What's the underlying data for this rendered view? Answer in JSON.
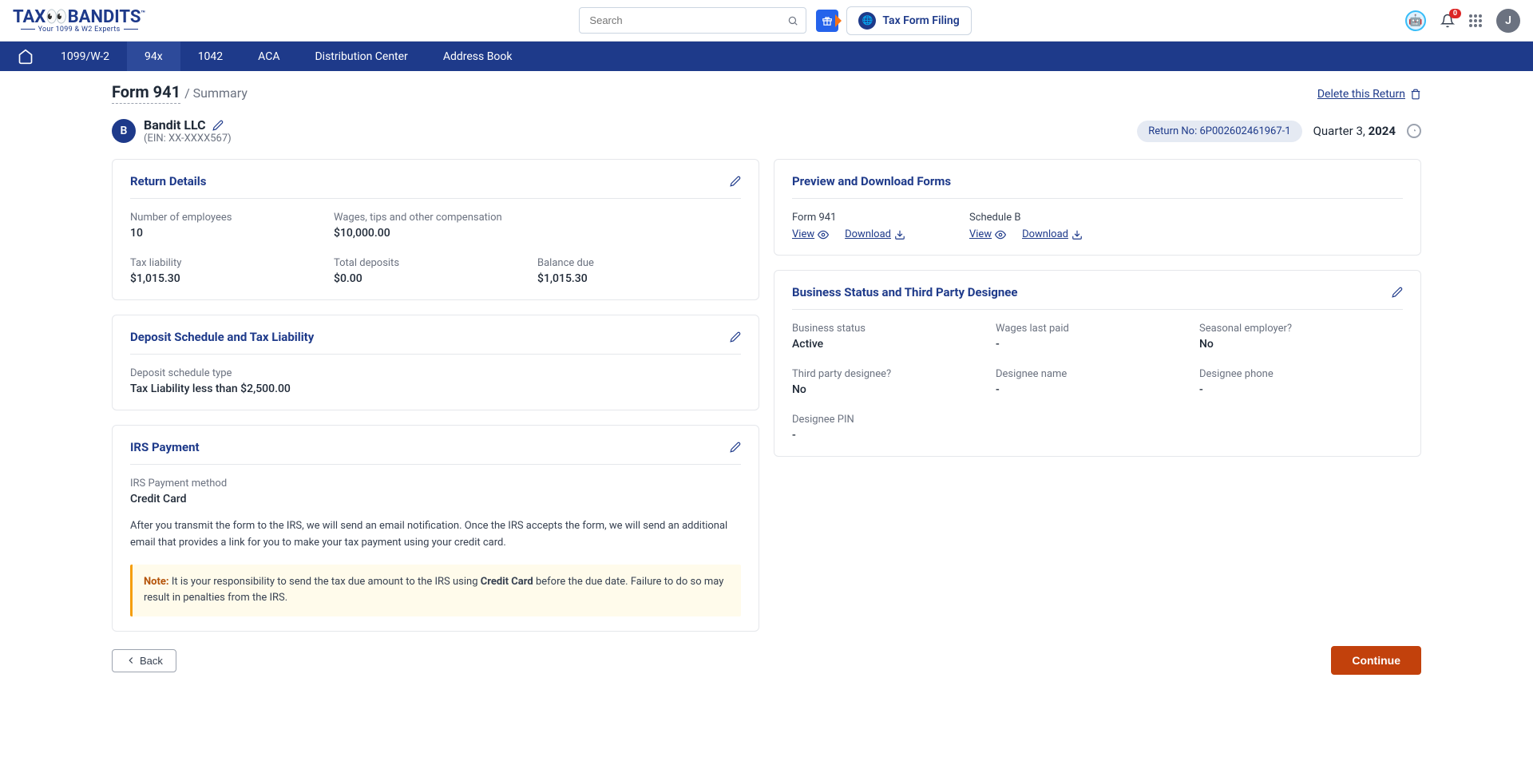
{
  "brand": {
    "name": "TAXBANDITS",
    "tagline": "Your 1099 & W2 Experts"
  },
  "header": {
    "search_placeholder": "Search",
    "tax_form_label": "Tax Form Filing",
    "notification_count": "0",
    "avatar_initial": "J"
  },
  "nav": {
    "items": [
      "1099/W-2",
      "94x",
      "1042",
      "ACA",
      "Distribution Center",
      "Address Book"
    ],
    "active_index": 1
  },
  "page": {
    "form_title": "Form 941",
    "breadcrumb": "/ Summary",
    "delete_label": "Delete this Return"
  },
  "entity": {
    "avatar": "B",
    "name": "Bandit LLC",
    "ein_label": "(EIN: XX-XXXX567)",
    "return_no_label": "Return No:",
    "return_no": "6P002602461967-1",
    "quarter_prefix": "Quarter 3,",
    "quarter_year": "2024"
  },
  "return_details": {
    "title": "Return Details",
    "fields": {
      "emp_label": "Number of employees",
      "emp_value": "10",
      "wages_label": "Wages, tips and other compensation",
      "wages_value": "$10,000.00",
      "tax_label": "Tax liability",
      "tax_value": "$1,015.30",
      "dep_label": "Total deposits",
      "dep_value": "$0.00",
      "bal_label": "Balance due",
      "bal_value": "$1,015.30"
    }
  },
  "deposit": {
    "title": "Deposit Schedule and Tax Liability",
    "type_label": "Deposit schedule type",
    "type_value": "Tax Liability less than $2,500.00"
  },
  "irs": {
    "title": "IRS Payment",
    "method_label": "IRS Payment method",
    "method_value": "Credit Card",
    "desc": "After you transmit the form to the IRS, we will send an email notification. Once the IRS accepts the form, we will send an additional email that provides a link for you to make your tax payment using your credit card.",
    "note_label": "Note:",
    "note_pre": " It is your responsibility to send the tax due amount to the IRS using ",
    "note_bold": "Credit Card",
    "note_post": " before the due date. Failure to do so may result in penalties from the IRS."
  },
  "preview": {
    "title": "Preview and Download Forms",
    "form941_label": "Form 941",
    "scheduleb_label": "Schedule B",
    "view": "View",
    "download": "Download"
  },
  "business": {
    "title": "Business Status and Third Party Designee",
    "status_label": "Business status",
    "status_value": "Active",
    "wages_label": "Wages last paid",
    "wages_value": "-",
    "seasonal_label": "Seasonal employer?",
    "seasonal_value": "No",
    "third_label": "Third party designee?",
    "third_value": "No",
    "dname_label": "Designee name",
    "dname_value": "-",
    "dphone_label": "Designee phone",
    "dphone_value": "-",
    "dpin_label": "Designee PIN",
    "dpin_value": "-"
  },
  "footer": {
    "back": "Back",
    "continue": "Continue"
  }
}
